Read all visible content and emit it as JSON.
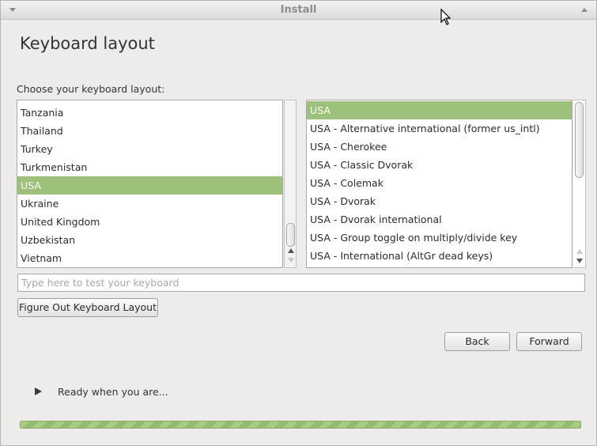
{
  "window": {
    "title": "Install"
  },
  "page": {
    "heading": "Keyboard layout",
    "choose_label": "Choose your keyboard layout:"
  },
  "countries": {
    "items": [
      "Tanzania",
      "Thailand",
      "Turkey",
      "Turkmenistan",
      "USA",
      "Ukraine",
      "United Kingdom",
      "Uzbekistan",
      "Vietnam"
    ],
    "selected": "USA"
  },
  "variants": {
    "items": [
      "USA",
      "USA - Alternative international (former us_intl)",
      "USA - Cherokee",
      "USA - Classic Dvorak",
      "USA - Colemak",
      "USA - Dvorak",
      "USA - Dvorak international",
      "USA - Group toggle on multiply/divide key",
      "USA - International (AltGr dead keys)"
    ],
    "selected": "USA"
  },
  "test_input": {
    "value": "",
    "placeholder": "Type here to test your keyboard"
  },
  "buttons": {
    "figure_out": "Figure Out Keyboard Layout",
    "back": "Back",
    "forward": "Forward"
  },
  "status": {
    "text": "Ready when you are..."
  },
  "progress": {
    "value": 1.0
  },
  "colors": {
    "selection": "#9dc07a",
    "progress": "#a7cc84"
  }
}
